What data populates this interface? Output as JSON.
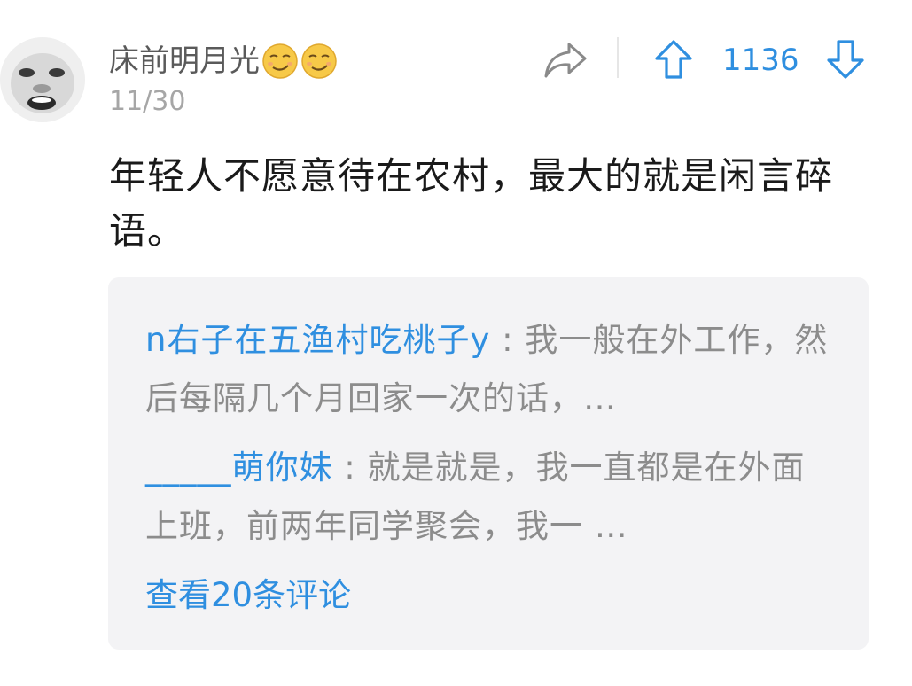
{
  "comment": {
    "username": "床前明月光",
    "username_emojis": [
      "smirk-emoji",
      "smirk-emoji"
    ],
    "date": "11/30",
    "vote_count": "1136",
    "body": "年轻人不愿意待在农村，最大的就是闲言碎语。"
  },
  "replies": [
    {
      "author": "n右子在五渔村吃桃子y",
      "separator": " : ",
      "text": "我一般在外工作，然后每隔几个月回家一次的话，…"
    },
    {
      "author": "_____萌你妹",
      "separator": " : ",
      "text": "就是就是，我一直都是在外面上班，前两年同学聚会，我一 …"
    }
  ],
  "view_all_label": "查看20条评论",
  "icons": {
    "share": "share-icon",
    "upvote": "upvote-icon",
    "downvote": "downvote-icon"
  },
  "colors": {
    "accent": "#2f8fe0",
    "username": "#5a5a5a",
    "meta": "#a6a6a6",
    "reply_bg": "#f3f3f5"
  }
}
